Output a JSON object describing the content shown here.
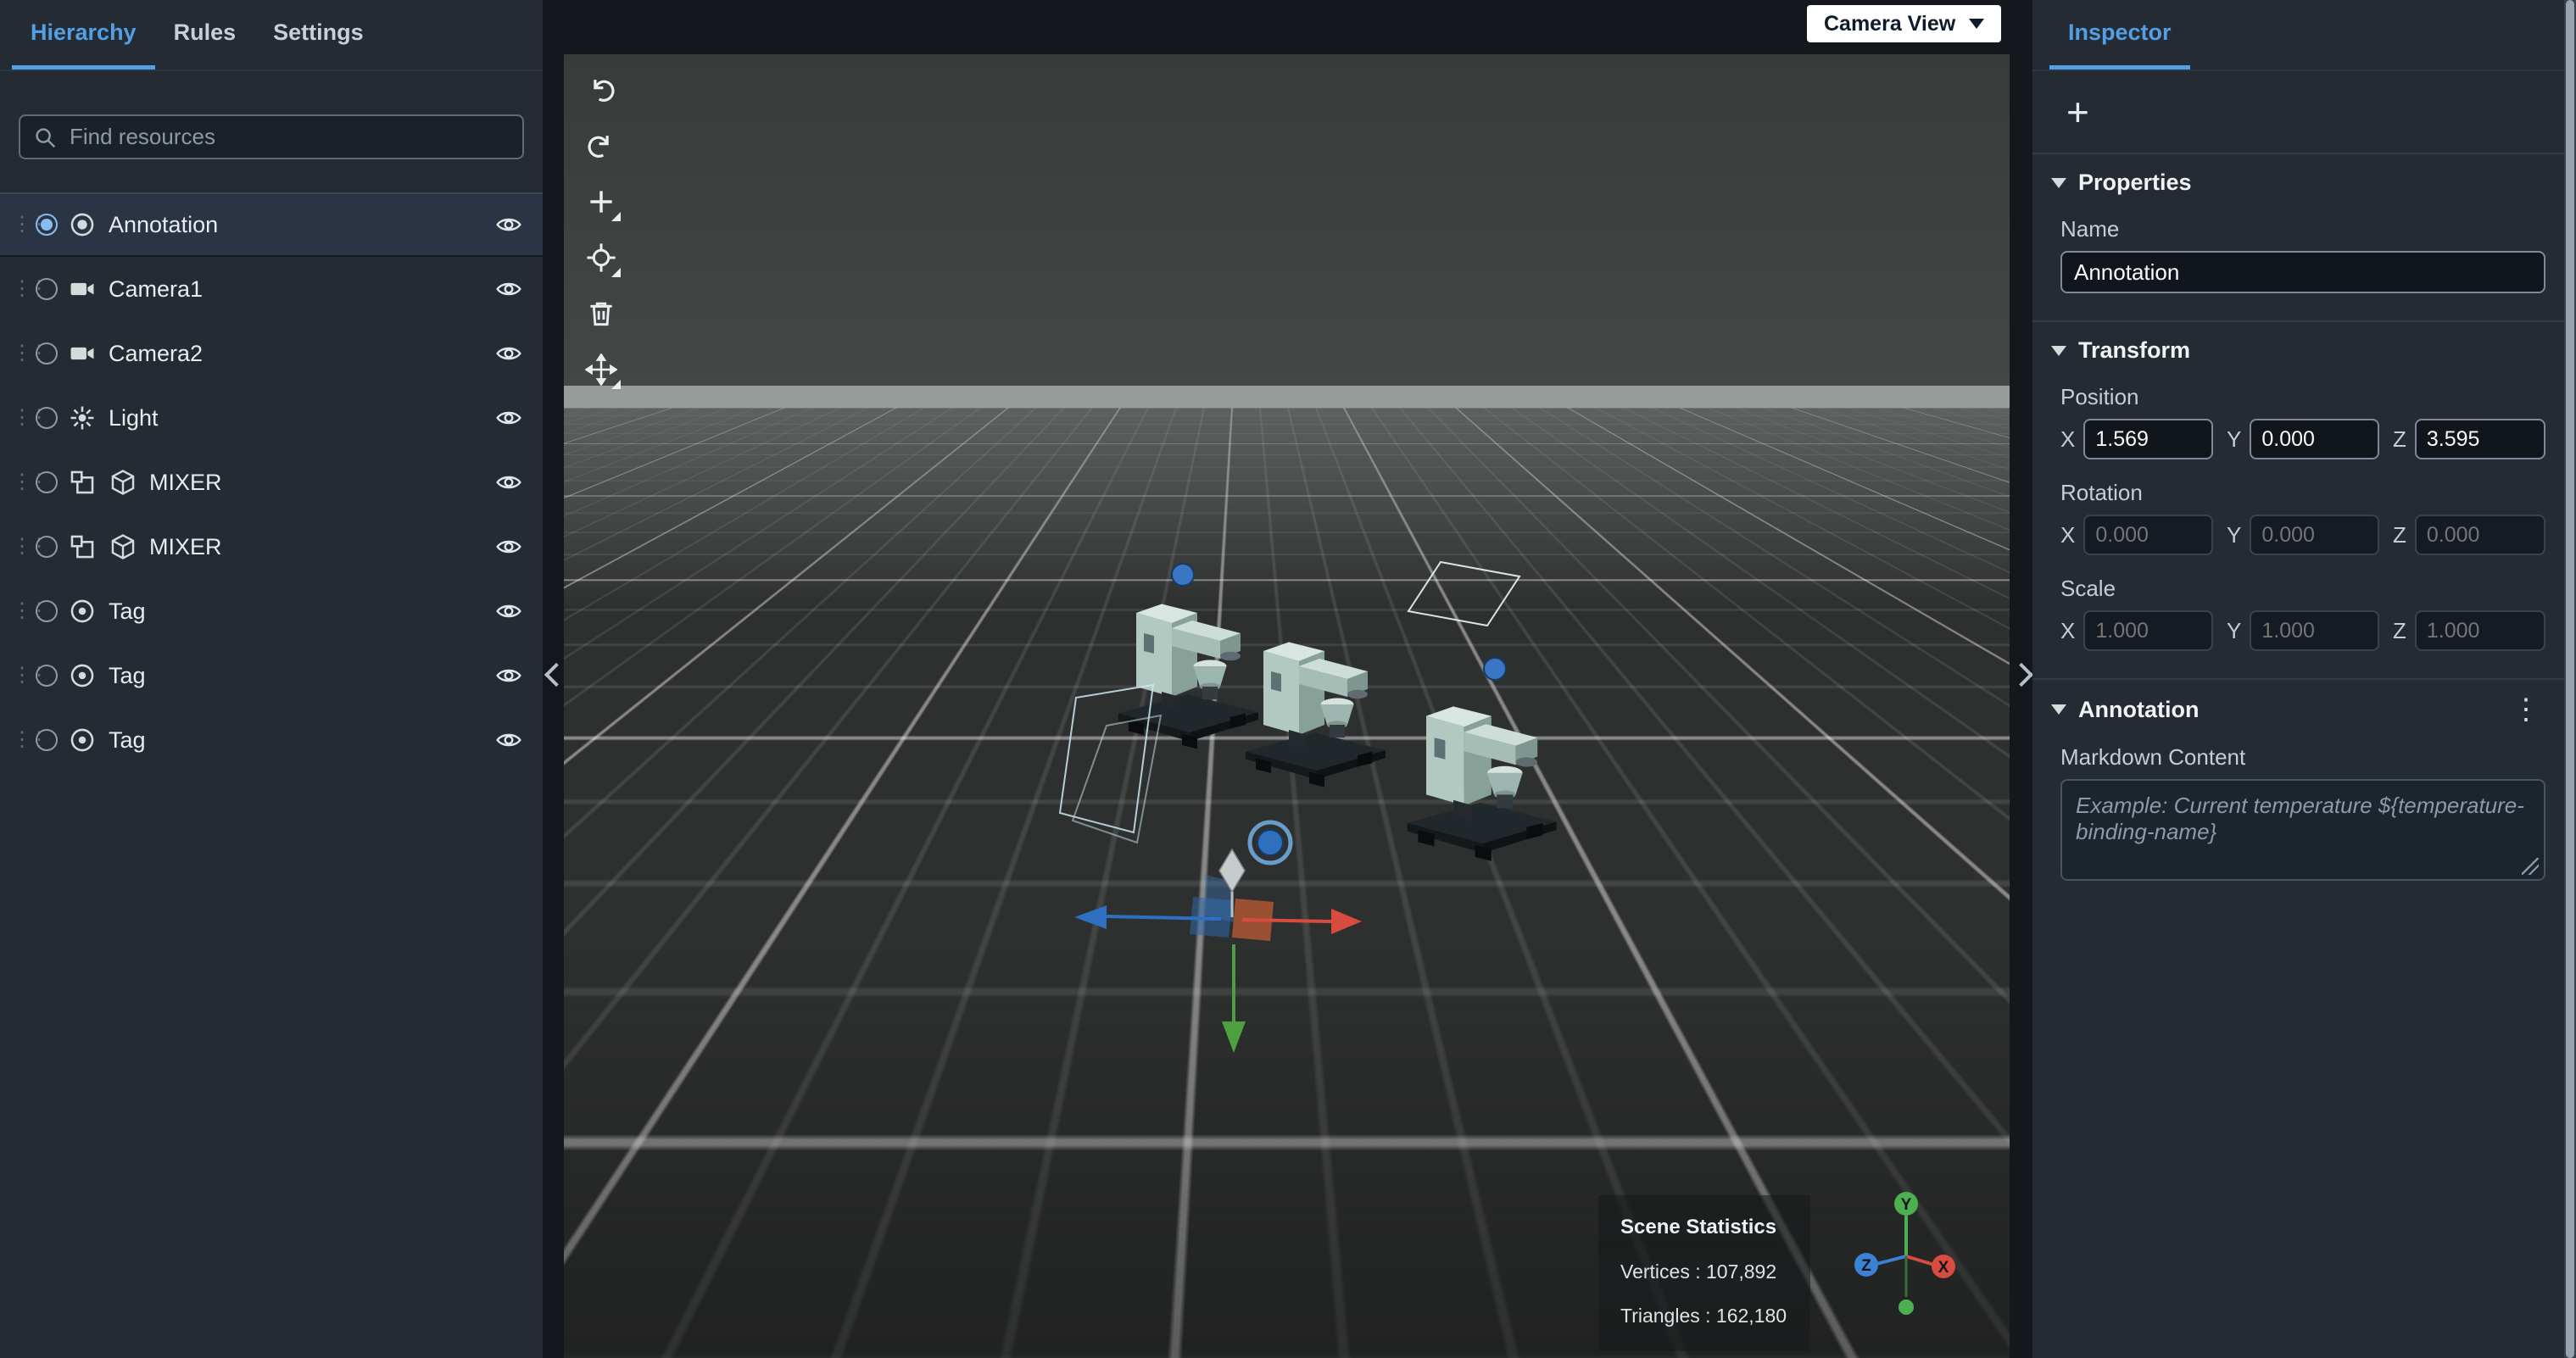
{
  "left_panel": {
    "tabs": [
      {
        "label": "Hierarchy"
      },
      {
        "label": "Rules"
      },
      {
        "label": "Settings"
      }
    ],
    "search_placeholder": "Find resources",
    "tree": [
      {
        "label": "Annotation",
        "icon": "annotation-icon",
        "selected": true
      },
      {
        "label": "Camera1",
        "icon": "camera-icon"
      },
      {
        "label": "Camera2",
        "icon": "camera-icon"
      },
      {
        "label": "Light",
        "icon": "light-icon"
      },
      {
        "label": "MIXER",
        "icon": "component-icon cube-icon"
      },
      {
        "label": "MIXER",
        "icon": "component-icon cube-icon"
      },
      {
        "label": "Tag",
        "icon": "tag-icon"
      },
      {
        "label": "Tag",
        "icon": "tag-icon"
      },
      {
        "label": "Tag",
        "icon": "tag-icon"
      }
    ]
  },
  "viewport": {
    "camera_view_label": "Camera View",
    "scene_stats": {
      "title": "Scene Statistics",
      "vertices": "Vertices : 107,892",
      "triangles": "Triangles : 162,180"
    },
    "axis_gizmo": {
      "x": "X",
      "y": "Y",
      "z": "Z"
    }
  },
  "inspector": {
    "tab_label": "Inspector",
    "add_label": "+",
    "properties": {
      "title": "Properties",
      "name_label": "Name",
      "name_value": "Annotation"
    },
    "transform": {
      "title": "Transform",
      "position_label": "Position",
      "rotation_label": "Rotation",
      "scale_label": "Scale",
      "x_label": "X",
      "y_label": "Y",
      "z_label": "Z",
      "position": {
        "x": "1.569",
        "y": "0.000",
        "z": "3.595"
      },
      "rotation": {
        "x": "0.000",
        "y": "0.000",
        "z": "0.000"
      },
      "scale": {
        "x": "1.000",
        "y": "1.000",
        "z": "1.000"
      }
    },
    "annotation": {
      "title": "Annotation",
      "markdown_label": "Markdown Content",
      "markdown_placeholder": "Example: Current temperature ${temperature-binding-name}"
    }
  },
  "colors": {
    "accent": "#539fe5",
    "axis_x": "#d84b3f",
    "axis_y": "#4caf50",
    "axis_z": "#3b82d4"
  }
}
